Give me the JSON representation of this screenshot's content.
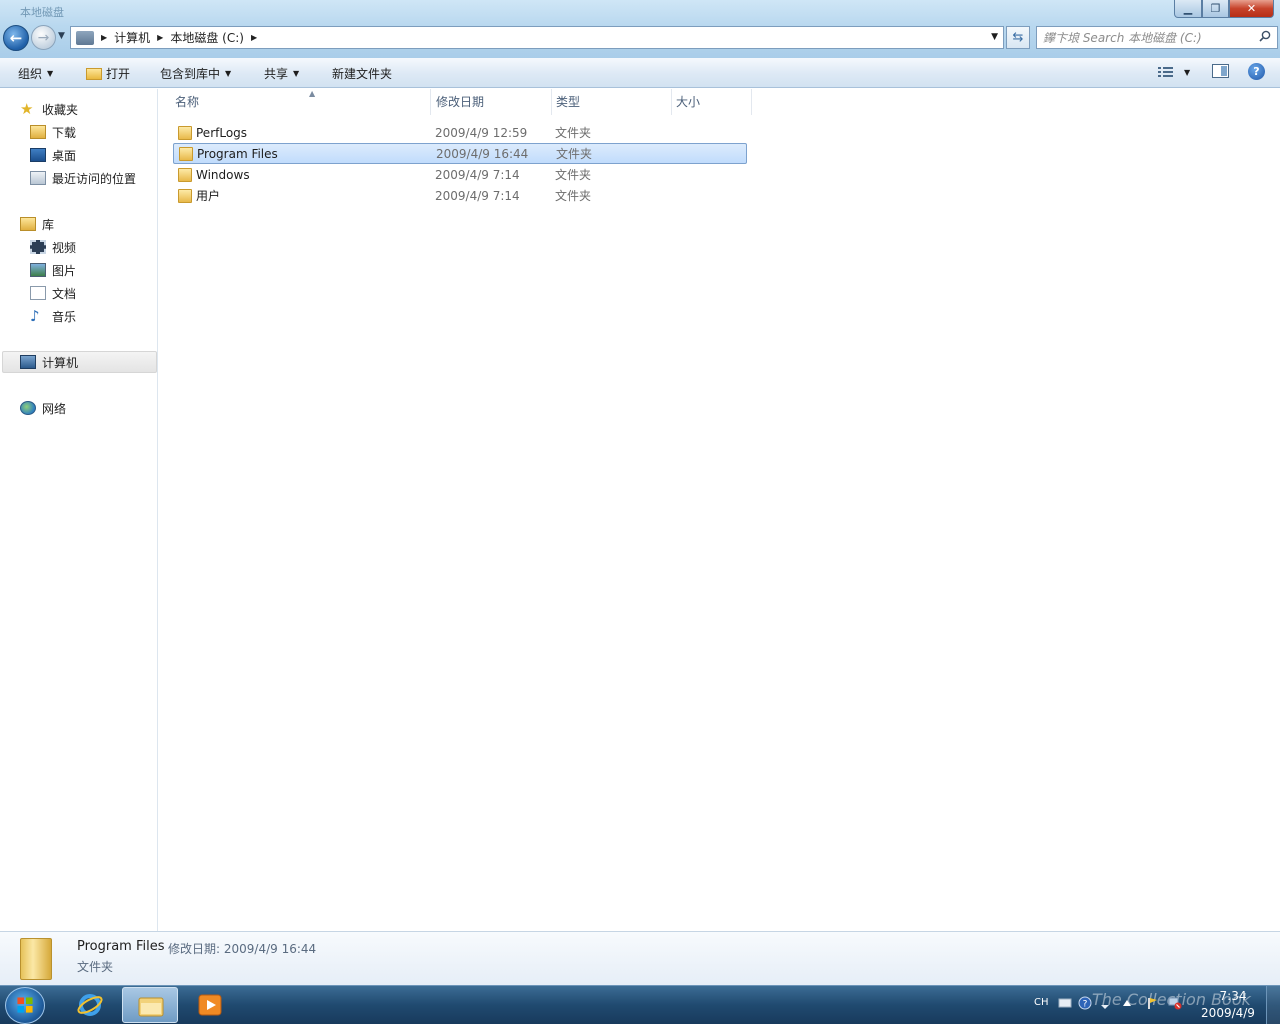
{
  "window": {
    "title": "本地磁盘"
  },
  "nav_buttons": {
    "back": "←",
    "forward": "→"
  },
  "breadcrumb": [
    "计算机",
    "本地磁盘 (C:)"
  ],
  "search": {
    "placeholder": "鑻卞埌 Search 本地磁盘 (C:)"
  },
  "toolbar": {
    "organize": "组织",
    "open": "打开",
    "include_in_library": "包含到库中",
    "share": "共享",
    "new_folder": "新建文件夹",
    "help": "?"
  },
  "sidebar": {
    "favorites": {
      "label": "收藏夹",
      "items": [
        "下载",
        "桌面",
        "最近访问的位置"
      ]
    },
    "libraries": {
      "label": "库",
      "items": [
        "视频",
        "图片",
        "文档",
        "音乐"
      ]
    },
    "computer": "计算机",
    "network": "网络"
  },
  "columns": {
    "name": "名称",
    "modified": "修改日期",
    "type": "类型",
    "size": "大小"
  },
  "files": [
    {
      "name": "PerfLogs",
      "modified": "2009/4/9 12:59",
      "type": "文件夹",
      "selected": false
    },
    {
      "name": "Program Files",
      "modified": "2009/4/9 16:44",
      "type": "文件夹",
      "selected": true
    },
    {
      "name": "Windows",
      "modified": "2009/4/9 7:14",
      "type": "文件夹",
      "selected": false
    },
    {
      "name": "用户",
      "modified": "2009/4/9 7:14",
      "type": "文件夹",
      "selected": false
    }
  ],
  "details": {
    "name": "Program Files",
    "modified_text": "修改日期: 2009/4/9 16:44",
    "type": "文件夹"
  },
  "taskbar": {
    "language": "CH",
    "time": "7:34",
    "date": "2009/4/9",
    "watermark": "The Collection Book"
  },
  "colors": {
    "selection": "#c1dcfc",
    "selection_border": "#7da2ce",
    "taskbar": "#204a70",
    "folder": "#e8b94a"
  }
}
